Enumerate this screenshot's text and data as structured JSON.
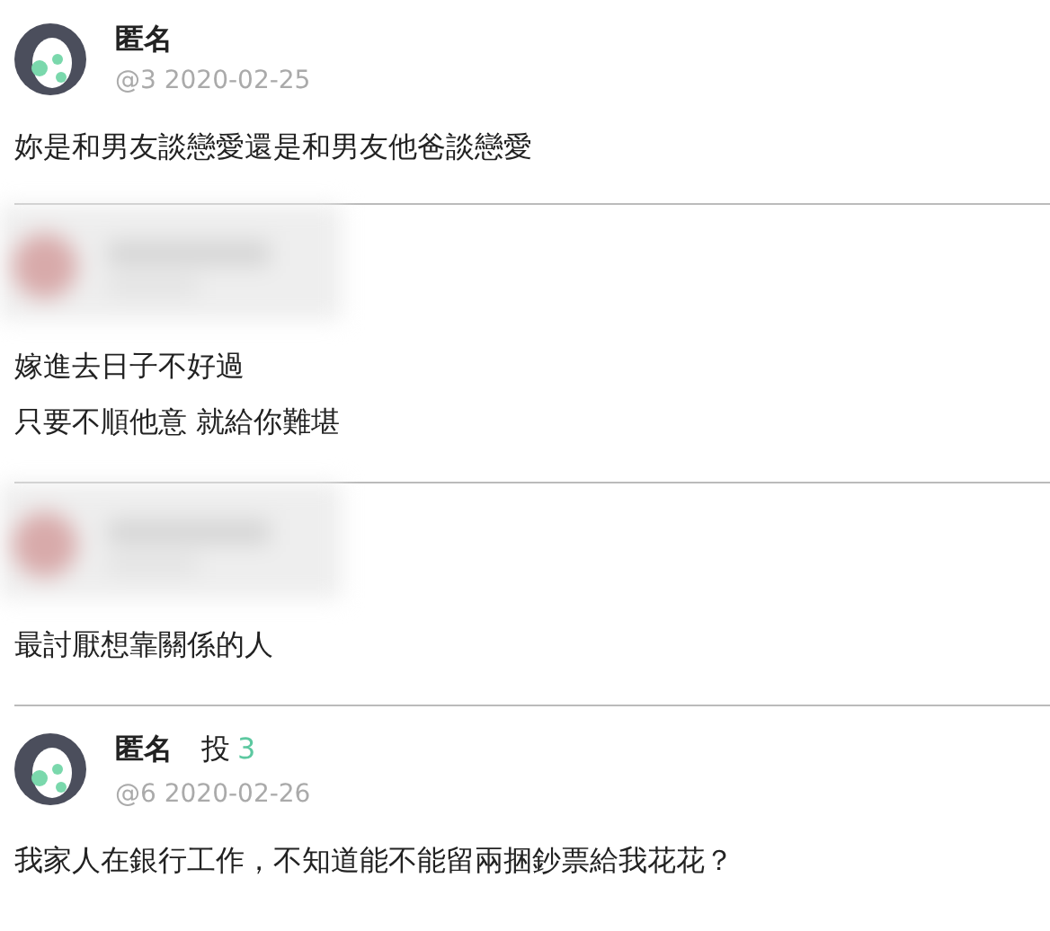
{
  "posts": [
    {
      "kind": "anonymous",
      "name": "匿名",
      "floor": "@3",
      "date": "2020-02-25",
      "lines": [
        "妳是和男友談戀愛還是和男友他爸談戀愛"
      ]
    },
    {
      "kind": "blurred",
      "lines": [
        "嫁進去日子不好過",
        "只要不順他意 就給你難堪"
      ]
    },
    {
      "kind": "blurred",
      "lines": [
        "最討厭想靠關係的人"
      ]
    },
    {
      "kind": "anonymous",
      "name": "匿名",
      "vote_label": "投",
      "vote_count": "3",
      "floor": "@6",
      "date": "2020-02-26",
      "lines": [
        "我家人在銀行工作，不知道能不能留兩捆鈔票給我花花？"
      ]
    }
  ]
}
